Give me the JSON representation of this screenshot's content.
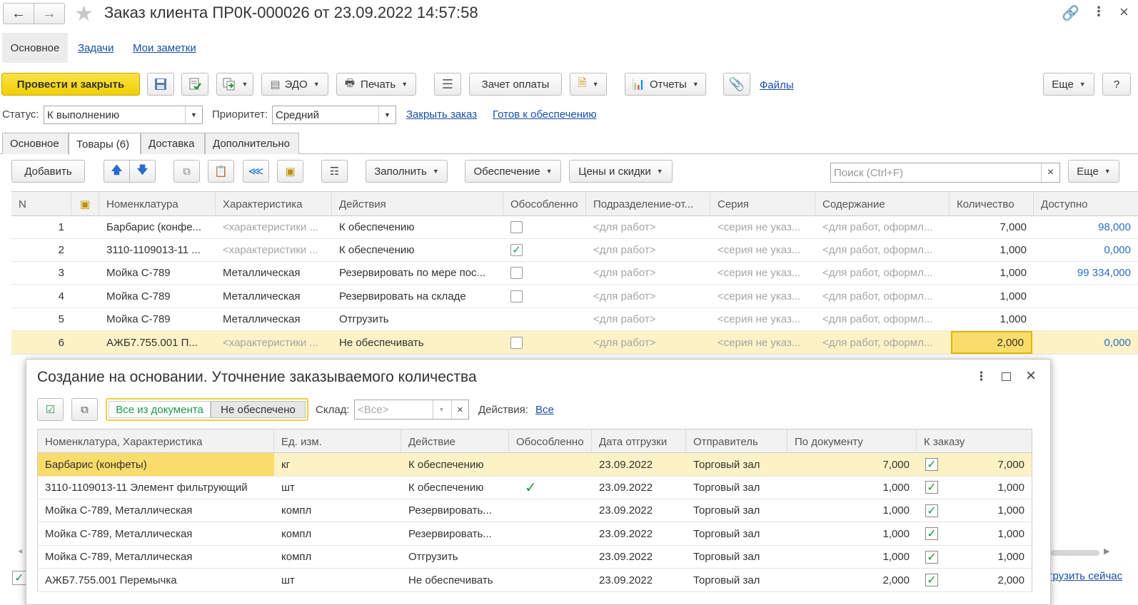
{
  "header": {
    "title": "Заказ клиента ПР0К-000026 от 23.09.2022 14:57:58"
  },
  "nav": {
    "tabs": [
      "Основное",
      "Задачи",
      "Мои заметки"
    ]
  },
  "toolbar": {
    "post_close": "Провести и закрыть",
    "edo": "ЭДО",
    "print": "Печать",
    "payment_offset": "Зачет оплаты",
    "reports": "Отчеты",
    "files": "Файлы",
    "more": "Еще",
    "help": "?"
  },
  "status_row": {
    "status_label": "Статус:",
    "status_value": "К выполнению",
    "priority_label": "Приоритет:",
    "priority_value": "Средний",
    "close_order": "Закрыть заказ",
    "ready": "Готов к обеспечению"
  },
  "doc_tabs": [
    "Основное",
    "Товары (6)",
    "Доставка",
    "Дополнительно"
  ],
  "goods_toolbar": {
    "add": "Добавить",
    "fill": "Заполнить",
    "provision": "Обеспечение",
    "prices": "Цены и скидки",
    "search_placeholder": "Поиск (Ctrl+F)",
    "more": "Еще"
  },
  "goods_table": {
    "columns": [
      "N",
      "",
      "Номенклатура",
      "Характеристика",
      "Действия",
      "Обособленно",
      "Подразделение-от...",
      "Серия",
      "Содержание",
      "Количество",
      "Доступно"
    ],
    "rows": [
      {
        "n": "1",
        "item": "Барбарис (конфе...",
        "char": "<характеристики ...",
        "action": "К обеспечению",
        "separate": "unchecked",
        "dept": "<для работ>",
        "series": "<серия не указ...",
        "content": "<для работ, оформл...",
        "qty": "7,000",
        "avail": "98,000"
      },
      {
        "n": "2",
        "item": "3110-1109013-11 ...",
        "char": "<характеристики ...",
        "action": "К обеспечению",
        "separate": "checked",
        "dept": "<для работ>",
        "series": "<серия не указ...",
        "content": "<для работ, оформл...",
        "qty": "1,000",
        "avail": "0,000"
      },
      {
        "n": "3",
        "item": "Мойка С-789",
        "char": "Металлическая",
        "action": "Резервировать по мере пос...",
        "separate": "unchecked",
        "dept": "<для работ>",
        "series": "<серия не указ...",
        "content": "<для работ, оформл...",
        "qty": "1,000",
        "avail": "99 334,000"
      },
      {
        "n": "4",
        "item": "Мойка С-789",
        "char": "Металлическая",
        "action": "Резервировать на складе",
        "separate": "unchecked",
        "dept": "<для работ>",
        "series": "<серия не указ...",
        "content": "<для работ, оформл...",
        "qty": "1,000",
        "avail": ""
      },
      {
        "n": "5",
        "item": "Мойка С-789",
        "char": "Металлическая",
        "action": "Отгрузить",
        "separate": "none",
        "dept": "<для работ>",
        "series": "<серия не указ...",
        "content": "<для работ, оформл...",
        "qty": "1,000",
        "avail": ""
      },
      {
        "n": "6",
        "item": "АЖБ7.755.001 П...",
        "char": "<характеристики ...",
        "action": "Не обеспечивать",
        "separate": "unchecked",
        "dept": "<для работ>",
        "series": "<серия не указ...",
        "content": "<для работ, оформл...",
        "qty": "2,000",
        "avail": "0,000"
      }
    ]
  },
  "footer_link": "грузить сейчас",
  "dialog": {
    "title": "Создание на основании. Уточнение заказываемого количества",
    "filter_all": "Все из документа",
    "filter_not": "Не обеспечено",
    "warehouse_label": "Склад:",
    "warehouse_placeholder": "<Все>",
    "actions_label": "Действия:",
    "actions_link": "Все",
    "columns": [
      "Номенклатура, Характеристика",
      "Ед. изм.",
      "Действие",
      "Обособленно",
      "Дата отгрузки",
      "Отправитель",
      "По документу",
      "К заказу"
    ],
    "rows": [
      {
        "item": "Барбарис (конфеты)",
        "unit": "кг",
        "action": "К обеспечению",
        "separate": false,
        "date": "23.09.2022",
        "sender": "Торговый зал",
        "doc_qty": "7,000",
        "order_qty": "7,000"
      },
      {
        "item": "3110-1109013-11 Элемент фильтрующий",
        "unit": "шт",
        "action": "К обеспечению",
        "separate": true,
        "date": "23.09.2022",
        "sender": "Торговый зал",
        "doc_qty": "1,000",
        "order_qty": "1,000"
      },
      {
        "item": "Мойка С-789, Металлическая",
        "unit": "компл",
        "action": "Резервировать...",
        "separate": false,
        "date": "23.09.2022",
        "sender": "Торговый зал",
        "doc_qty": "1,000",
        "order_qty": "1,000"
      },
      {
        "item": "Мойка С-789, Металлическая",
        "unit": "компл",
        "action": "Резервировать...",
        "separate": false,
        "date": "23.09.2022",
        "sender": "Торговый зал",
        "doc_qty": "1,000",
        "order_qty": "1,000"
      },
      {
        "item": "Мойка С-789, Металлическая",
        "unit": "компл",
        "action": "Отгрузить",
        "separate": false,
        "date": "23.09.2022",
        "sender": "Торговый зал",
        "doc_qty": "1,000",
        "order_qty": "1,000"
      },
      {
        "item": "АЖБ7.755.001 Перемычка",
        "unit": "шт",
        "action": "Не обеспечивать",
        "separate": false,
        "date": "23.09.2022",
        "sender": "Торговый зал",
        "doc_qty": "2,000",
        "order_qty": "2,000"
      }
    ]
  },
  "colors": {
    "primary_button": "#f5d800",
    "selected_row": "#fcf2c6",
    "link": "#1a4fa8",
    "check": "#1a9a4a"
  }
}
